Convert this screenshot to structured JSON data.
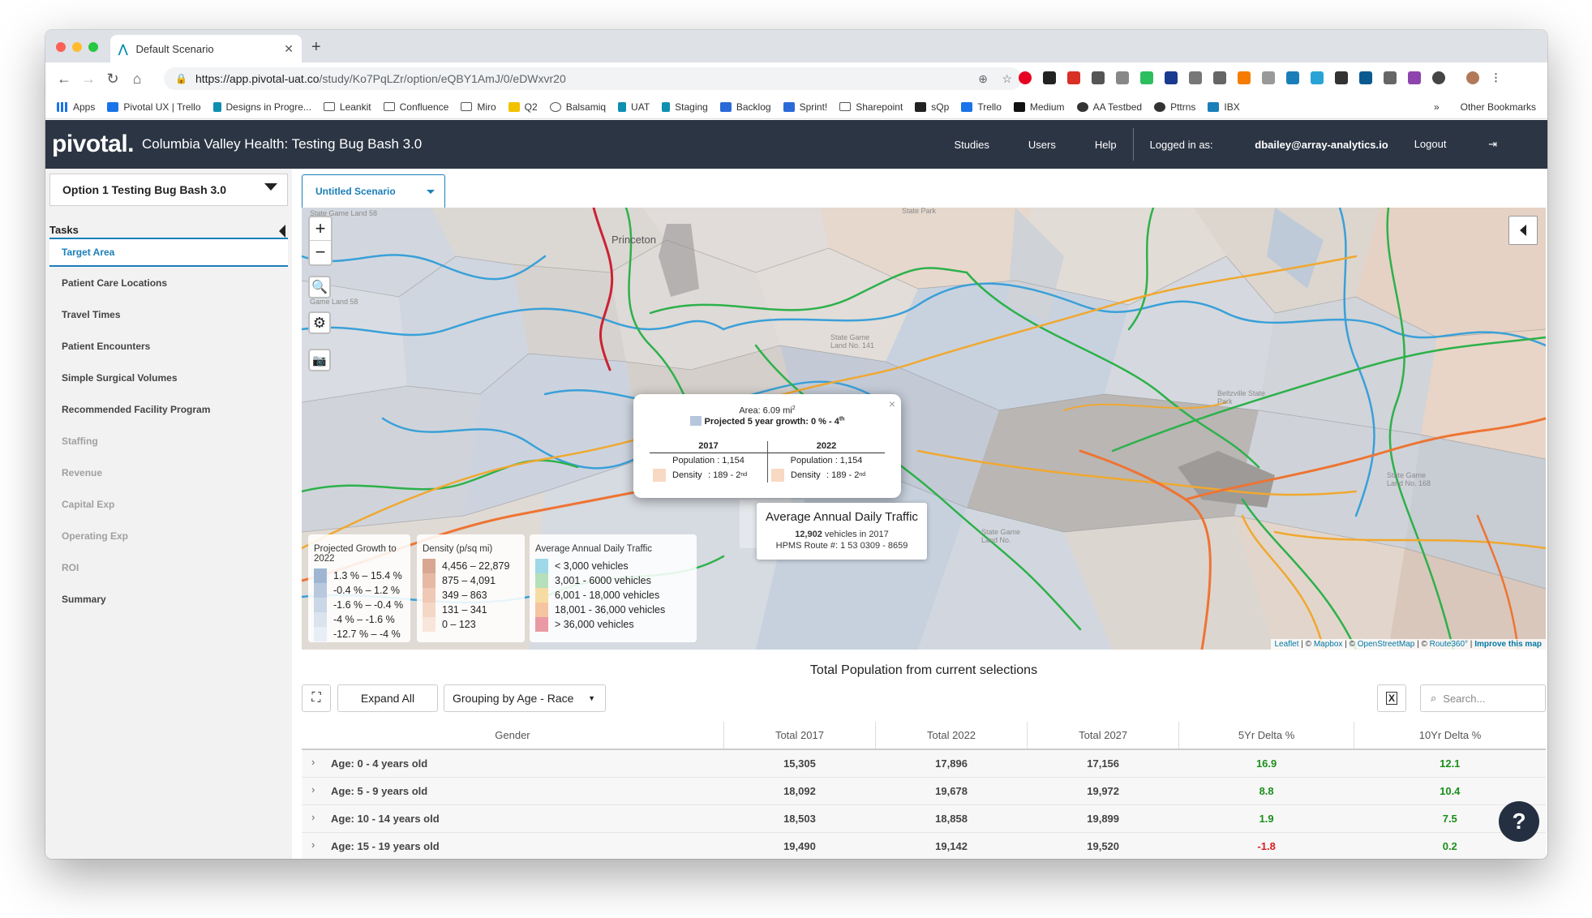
{
  "browser": {
    "tab_title": "Default Scenario",
    "url_main": "https://app.pivotal-uat.co",
    "url_rest": "/study/Ko7PqLZr/option/eQBY1AmJ/0/eDWxvr20",
    "bookmarks": [
      "Apps",
      "Pivotal UX | Trello",
      "Designs in Progre...",
      "Leankit",
      "Confluence",
      "Miro",
      "Q2",
      "Balsamiq",
      "UAT",
      "Staging",
      "Backlog",
      "Sprint!",
      "Sharepoint",
      "sQp",
      "Trello",
      "Medium",
      "AA Testbed",
      "Pttrns",
      "IBX"
    ],
    "other_bookmarks": "Other Bookmarks",
    "more": "»"
  },
  "app": {
    "brand": "pivotal.",
    "title": "Columbia Valley Health: Testing Bug Bash 3.0",
    "nav": {
      "studies": "Studies",
      "users": "Users",
      "help": "Help",
      "logged_prefix": "Logged in as: ",
      "user": "dbailey@array-analytics.io",
      "logout": "Logout"
    }
  },
  "sidebar": {
    "option": "Option 1 Testing Bug Bash 3.0",
    "tasks_label": "Tasks",
    "tasks": [
      {
        "label": "Target Area",
        "state": "active"
      },
      {
        "label": "Patient Care Locations",
        "state": "enabled"
      },
      {
        "label": "Travel Times",
        "state": "enabled"
      },
      {
        "label": "Patient Encounters",
        "state": "enabled"
      },
      {
        "label": "Simple Surgical Volumes",
        "state": "enabled"
      },
      {
        "label": "Recommended Facility Program",
        "state": "enabled"
      },
      {
        "label": "Staffing",
        "state": "disabled"
      },
      {
        "label": "Revenue",
        "state": "disabled"
      },
      {
        "label": "Capital Exp",
        "state": "disabled"
      },
      {
        "label": "Operating Exp",
        "state": "disabled"
      },
      {
        "label": "ROI",
        "state": "disabled"
      },
      {
        "label": "Summary",
        "state": "enabled"
      }
    ]
  },
  "scenario_tab": "Untitled Scenario",
  "map": {
    "places": [
      "Princeton",
      "State Park",
      "State Game Land 58",
      "Game Land 58",
      "State Game Land No. 141",
      "Beltzville State Park",
      "State Game Land No. 168",
      "State Game Land No."
    ],
    "popup": {
      "area": "Area: 6.09 mi",
      "area_sup": "2",
      "growth": "Projected 5 year growth: 0 % - 4",
      "growth_sup": "th",
      "close": "×",
      "years": [
        {
          "year": "2017",
          "population": "Population : 1,154",
          "density_label": "Density",
          "density": ": 189 - 2",
          "density_sup": "nd"
        },
        {
          "year": "2022",
          "population": "Population : 1,154",
          "density_label": "Density",
          "density": ": 189 - 2",
          "density_sup": "nd"
        }
      ]
    },
    "tooltip": {
      "title": "Average Annual Daily Traffic",
      "vehicles_num": "12,902",
      "vehicles_text": " vehicles in 2017",
      "route": "HPMS Route #: 1 53 0309 - 8659"
    },
    "legends": {
      "growth": {
        "title": "Projected Growth to 2022",
        "rows": [
          "1.3 %  –  15.4 %",
          "-0.4 %  –  1.2 %",
          "-1.6 %  –  -0.4 %",
          "-4 %  –  -1.6 %",
          "-12.7 %  –  -4 %"
        ],
        "colors": [
          "#9fb6d2",
          "#b8c9de",
          "#cad7e6",
          "#dae3ee",
          "#e8eef5"
        ]
      },
      "density": {
        "title": "Density (p/sq mi)",
        "rows": [
          "4,456  –  22,879",
          "875  –  4,091",
          "349  –  863",
          "131  –  341",
          "0  –  123"
        ],
        "colors": [
          "#d9a791",
          "#e6b9a4",
          "#efc9b5",
          "#f5d7c6",
          "#f9e6da"
        ]
      },
      "traffic": {
        "title": "Average Annual Daily Traffic",
        "rows": [
          "<   3,000 vehicles",
          "3,001  - 6000 vehicles",
          "6,001  - 18,000 vehicles",
          "18,001 - 36,000 vehicles",
          "> 36,000 vehicles"
        ],
        "colors": [
          "#9fd8e8",
          "#b5e0b9",
          "#f6dca2",
          "#f5c4a0",
          "#ea9aa5"
        ]
      }
    },
    "attribution": {
      "leaflet": "Leaflet",
      "mapbox": "Mapbox",
      "osm": "OpenStreetMap",
      "route": "Route360°",
      "improve": "Improve this map"
    }
  },
  "table": {
    "title": "Total Population from current selections",
    "expand_all": "Expand All",
    "grouping": "Grouping by Age - Race",
    "search_placeholder": "Search...",
    "columns": [
      "Gender",
      "Total 2017",
      "Total 2022",
      "Total 2027",
      "5Yr Delta %",
      "10Yr Delta %"
    ],
    "rows": [
      {
        "label": "Age: 0 - 4 years old",
        "t2017": "15,305",
        "t2022": "17,896",
        "t2027": "17,156",
        "d5": "16.9",
        "d10": "12.1",
        "d5_sign": "pos",
        "d10_sign": "pos"
      },
      {
        "label": "Age: 5 - 9 years old",
        "t2017": "18,092",
        "t2022": "19,678",
        "t2027": "19,972",
        "d5": "8.8",
        "d10": "10.4",
        "d5_sign": "pos",
        "d10_sign": "pos"
      },
      {
        "label": "Age: 10 - 14 years old",
        "t2017": "18,503",
        "t2022": "18,858",
        "t2027": "19,899",
        "d5": "1.9",
        "d10": "7.5",
        "d5_sign": "pos",
        "d10_sign": "pos"
      },
      {
        "label": "Age: 15 - 19 years old",
        "t2017": "19,490",
        "t2022": "19,142",
        "t2027": "19,520",
        "d5": "-1.8",
        "d10": "0.2",
        "d5_sign": "neg",
        "d10_sign": "pos"
      }
    ]
  },
  "help_label": "?"
}
